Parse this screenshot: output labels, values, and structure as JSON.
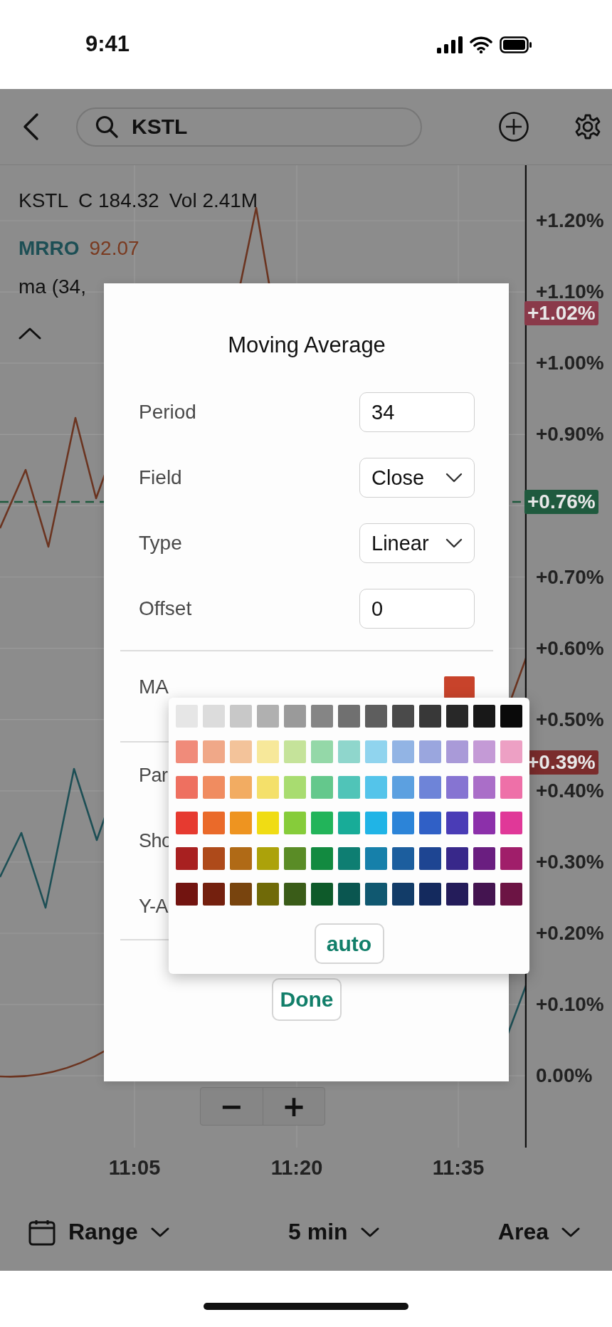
{
  "status_bar": {
    "time": "9:41"
  },
  "header": {
    "search_value": "KSTL"
  },
  "chart": {
    "legend": {
      "symbol": "KSTL",
      "close": "C 184.32",
      "volume": "Vol 2.41M"
    },
    "compare": {
      "symbol": "MRRO",
      "value": "92.07"
    },
    "study": "ma (34,",
    "y_labels": [
      "+1.20%",
      "+1.10%",
      "+1.00%",
      "+0.90%",
      "+0.70%",
      "+0.60%",
      "+0.50%",
      "+0.40%",
      "+0.30%",
      "+0.20%",
      "+0.10%",
      "0.00%"
    ],
    "badges": [
      {
        "text": "+1.02%",
        "color": "#8a3a4a"
      },
      {
        "text": "+0.76%",
        "color": "#1f5a3e"
      },
      {
        "text": "+0.39%",
        "color": "#7a2c2c"
      }
    ],
    "x_labels": [
      "11:05",
      "11:20",
      "11:35"
    ],
    "zoom_buttons": [
      "−",
      "+"
    ]
  },
  "toolbar": [
    {
      "label": "Range",
      "kind": "calendar"
    },
    {
      "label": "5 min",
      "kind": "plain"
    },
    {
      "label": "Area",
      "kind": "plain"
    }
  ],
  "dialog": {
    "title": "Moving Average",
    "fields": [
      {
        "label": "Period",
        "kind": "input",
        "value": "34"
      },
      {
        "label": "Field",
        "kind": "select",
        "value": "Close"
      },
      {
        "label": "Type",
        "kind": "select",
        "value": "Linear"
      },
      {
        "label": "Offset",
        "kind": "input",
        "value": "0"
      }
    ],
    "color_row": {
      "label": "MA",
      "color": "#c8432b"
    },
    "covered_rows": [
      "Par",
      "Sho",
      "Y-A"
    ],
    "done": "Done"
  },
  "color_picker": {
    "rows": [
      {
        "swatches": [
          {
            "color": "#e6e6e6"
          },
          {
            "color": "#dcdcdc"
          },
          {
            "color": "#c8c8c8"
          },
          {
            "color": "#b0b0b0"
          },
          {
            "color": "#9a9a9a"
          },
          {
            "color": "#858585"
          },
          {
            "color": "#707070"
          },
          {
            "color": "#5e5e5e"
          },
          {
            "color": "#4a4a4a"
          },
          {
            "color": "#383838"
          },
          {
            "color": "#282828"
          },
          {
            "color": "#181818"
          },
          {
            "color": "#0a0a0a"
          }
        ]
      },
      {
        "swatches": [
          {
            "color": "#f08b7a"
          },
          {
            "color": "#f0a888"
          },
          {
            "color": "#f3c39a"
          },
          {
            "color": "#f7e89a"
          },
          {
            "color": "#c5e39a"
          },
          {
            "color": "#94d8a8"
          },
          {
            "color": "#8fd6cc"
          },
          {
            "color": "#90d4ee"
          },
          {
            "color": "#92b4e4"
          },
          {
            "color": "#9aa6de"
          },
          {
            "color": "#a99ad8"
          },
          {
            "color": "#c49ad6"
          },
          {
            "color": "#eda0c4"
          }
        ]
      },
      {
        "swatches": [
          {
            "color": "#ee7060"
          },
          {
            "color": "#f08c60"
          },
          {
            "color": "#f2ac62"
          },
          {
            "color": "#f4e06a"
          },
          {
            "color": "#a8dc70"
          },
          {
            "color": "#64c88c"
          },
          {
            "color": "#50c4b8"
          },
          {
            "color": "#54c4ea"
          },
          {
            "color": "#5ca0e0"
          },
          {
            "color": "#6e84d8"
          },
          {
            "color": "#8674d2"
          },
          {
            "color": "#aa6ec8"
          },
          {
            "color": "#ee70a8"
          }
        ]
      },
      {
        "swatches": [
          {
            "color": "#e63a30"
          },
          {
            "color": "#ea6a2a"
          },
          {
            "color": "#ee9420"
          },
          {
            "color": "#f0dc14"
          },
          {
            "color": "#86cc3a"
          },
          {
            "color": "#22b45a"
          },
          {
            "color": "#18ac98"
          },
          {
            "color": "#20b4e6"
          },
          {
            "color": "#2c84d8"
          },
          {
            "color": "#3060c6"
          },
          {
            "color": "#4a3cb6"
          },
          {
            "color": "#8c30aa"
          },
          {
            "color": "#e03898"
          }
        ]
      },
      {
        "swatches": [
          {
            "color": "#a82020"
          },
          {
            "color": "#ae4a1a"
          },
          {
            "color": "#b06a16"
          },
          {
            "color": "#aca20a"
          },
          {
            "color": "#5a8c26"
          },
          {
            "color": "#128a40"
          },
          {
            "color": "#0e7e72"
          },
          {
            "color": "#1680aa"
          },
          {
            "color": "#1c5e9e"
          },
          {
            "color": "#1e4592"
          },
          {
            "color": "#38288a"
          },
          {
            "color": "#6a1e80"
          },
          {
            "color": "#a01e6a"
          }
        ]
      },
      {
        "swatches": [
          {
            "color": "#721410"
          },
          {
            "color": "#74200e"
          },
          {
            "color": "#78440e"
          },
          {
            "color": "#706a08"
          },
          {
            "color": "#3a5c18"
          },
          {
            "color": "#0e5a2a"
          },
          {
            "color": "#0a5650"
          },
          {
            "color": "#105870"
          },
          {
            "color": "#123c68"
          },
          {
            "color": "#142a5e"
          },
          {
            "color": "#241c5a"
          },
          {
            "color": "#441450"
          },
          {
            "color": "#6c1444"
          }
        ]
      }
    ],
    "auto": "auto"
  }
}
